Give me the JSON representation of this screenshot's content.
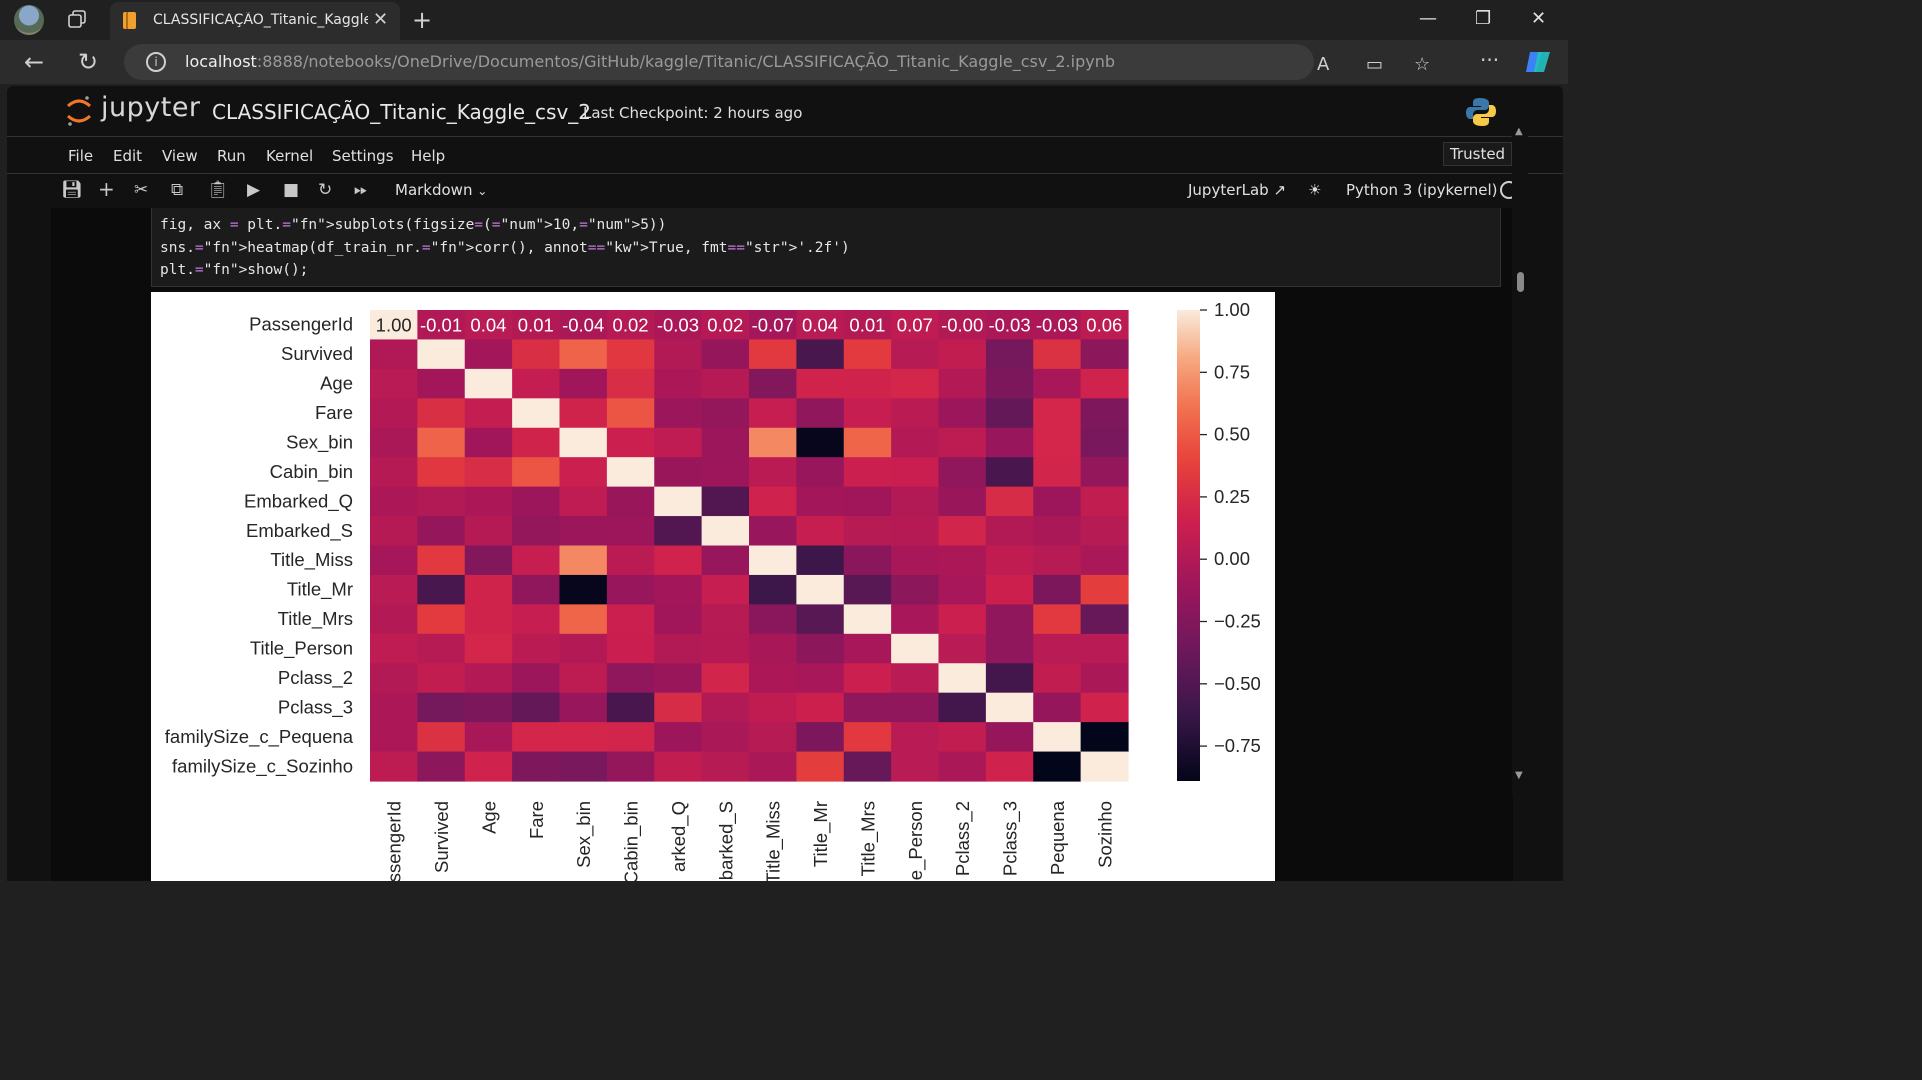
{
  "browser": {
    "tab_title": "CLASSIFICAÇÃO_Titanic_Kaggle_",
    "url_host": "localhost",
    "url_path": ":8888/notebooks/OneDrive/Documentos/GitHub/kaggle/Titanic/CLASSIFICAÇÃO_Titanic_Kaggle_csv_2.ipynb"
  },
  "jupyter": {
    "logo_text": "jupyter",
    "notebook_name": "CLASSIFICAÇÃO_Titanic_Kaggle_csv_2",
    "checkpoint": "Last Checkpoint: 2 hours ago",
    "menu": [
      "File",
      "Edit",
      "View",
      "Run",
      "Kernel",
      "Settings",
      "Help"
    ],
    "trusted": "Trusted",
    "cell_type": "Markdown",
    "jupyterlab_label": "JupyterLab",
    "kernel_name": "Python 3 (ipykernel)"
  },
  "code": {
    "line1": "fig, ax = plt.subplots(figsize=(10,5))",
    "line2": "sns.heatmap(df_train_nr.corr(), annot=True, fmt='.2f')",
    "line3": "plt.show();"
  },
  "chart_data": {
    "type": "heatmap",
    "row_labels": [
      "PassengerId",
      "Survived",
      "Age",
      "Fare",
      "Sex_bin",
      "Cabin_bin",
      "Embarked_Q",
      "Embarked_S",
      "Title_Miss",
      "Title_Mr",
      "Title_Mrs",
      "Title_Person",
      "Pclass_2",
      "Pclass_3",
      "familySize_c_Pequena",
      "familySize_c_Sozinho"
    ],
    "col_labels_visible": [
      "ssengerId",
      "Survived",
      "Age",
      "Fare",
      "Sex_bin",
      "Cabin_bin",
      "arked_Q",
      "barked_S",
      "Title_Miss",
      "Title_Mr",
      "Title_Mrs",
      "e_Person",
      "Pclass_2",
      "Pclass_3",
      "Pequena",
      "Sozinho"
    ],
    "first_row_annotations": [
      "1.00",
      "-0.01",
      "0.04",
      "0.01",
      "-0.04",
      "0.02",
      "-0.03",
      "0.02",
      "-0.07",
      "0.04",
      "0.01",
      "0.07",
      "-0.00",
      "-0.03",
      "-0.03",
      "0.06"
    ],
    "values": [
      [
        1.0,
        -0.01,
        0.04,
        0.01,
        -0.04,
        0.02,
        -0.03,
        0.02,
        -0.07,
        0.04,
        0.01,
        0.07,
        0.0,
        -0.03,
        -0.03,
        0.06
      ],
      [
        -0.01,
        1.0,
        -0.08,
        0.26,
        0.54,
        0.32,
        0.0,
        -0.15,
        0.33,
        -0.55,
        0.34,
        0.03,
        0.09,
        -0.32,
        0.28,
        -0.2
      ],
      [
        0.04,
        -0.08,
        1.0,
        0.1,
        -0.09,
        0.25,
        -0.03,
        0.02,
        -0.25,
        0.18,
        0.18,
        0.2,
        0.01,
        -0.28,
        -0.05,
        0.17
      ],
      [
        0.01,
        0.26,
        0.1,
        1.0,
        0.18,
        0.48,
        -0.12,
        -0.16,
        0.11,
        -0.18,
        0.11,
        0.05,
        -0.12,
        -0.41,
        0.2,
        -0.27
      ],
      [
        -0.04,
        0.54,
        -0.09,
        0.18,
        1.0,
        0.14,
        0.07,
        -0.12,
        0.69,
        -0.87,
        0.55,
        0.01,
        0.06,
        -0.14,
        0.2,
        -0.3
      ],
      [
        0.02,
        0.32,
        0.25,
        0.48,
        0.14,
        1.0,
        -0.13,
        -0.11,
        0.05,
        -0.14,
        0.14,
        0.13,
        -0.18,
        -0.54,
        0.19,
        -0.16
      ],
      [
        -0.03,
        0.0,
        -0.03,
        -0.12,
        0.07,
        -0.13,
        1.0,
        -0.5,
        0.17,
        -0.08,
        -0.09,
        0.0,
        -0.13,
        0.24,
        -0.11,
        0.09
      ],
      [
        0.02,
        -0.15,
        0.02,
        -0.16,
        -0.12,
        -0.11,
        -0.5,
        1.0,
        -0.14,
        0.11,
        0.03,
        0.02,
        0.19,
        0.0,
        -0.04,
        0.03
      ],
      [
        -0.07,
        0.33,
        -0.25,
        0.11,
        0.69,
        0.05,
        0.17,
        -0.14,
        1.0,
        -0.6,
        -0.21,
        -0.05,
        -0.03,
        0.08,
        0.03,
        -0.04
      ],
      [
        0.04,
        -0.55,
        0.18,
        -0.18,
        -0.87,
        -0.14,
        -0.08,
        0.11,
        -0.6,
        1.0,
        -0.47,
        -0.2,
        -0.06,
        0.15,
        -0.28,
        0.36
      ],
      [
        0.01,
        0.34,
        0.18,
        0.11,
        0.55,
        0.14,
        -0.09,
        0.03,
        -0.21,
        -0.47,
        1.0,
        -0.06,
        0.14,
        -0.18,
        0.33,
        -0.4
      ],
      [
        0.07,
        0.03,
        0.2,
        0.05,
        0.01,
        0.13,
        0.0,
        0.02,
        -0.05,
        -0.2,
        -0.06,
        1.0,
        0.04,
        -0.18,
        0.04,
        0.04
      ],
      [
        0.0,
        0.09,
        0.01,
        -0.12,
        0.06,
        -0.18,
        -0.13,
        0.19,
        -0.03,
        -0.06,
        0.14,
        0.04,
        1.0,
        -0.57,
        0.09,
        -0.04
      ],
      [
        -0.03,
        -0.32,
        -0.28,
        -0.41,
        -0.14,
        -0.54,
        0.24,
        0.0,
        0.08,
        0.15,
        -0.18,
        -0.18,
        -0.57,
        1.0,
        -0.15,
        0.17
      ],
      [
        -0.03,
        0.28,
        -0.05,
        0.2,
        0.2,
        0.19,
        -0.11,
        -0.04,
        0.03,
        -0.28,
        0.33,
        0.04,
        0.09,
        -0.15,
        1.0,
        -0.89
      ],
      [
        0.06,
        -0.2,
        0.17,
        -0.27,
        -0.3,
        -0.16,
        0.09,
        0.03,
        -0.04,
        0.36,
        -0.4,
        0.04,
        -0.04,
        0.17,
        -0.89,
        1.0
      ]
    ],
    "colormap": "rocket",
    "vmin": -0.89,
    "vmax": 1.0,
    "colorbar_ticks": [
      "1.00",
      "0.75",
      "0.50",
      "0.25",
      "0.00",
      "−0.25",
      "−0.50",
      "−0.75"
    ],
    "colorbar_values": [
      1.0,
      0.75,
      0.5,
      0.25,
      0.0,
      -0.25,
      -0.5,
      -0.75
    ]
  }
}
